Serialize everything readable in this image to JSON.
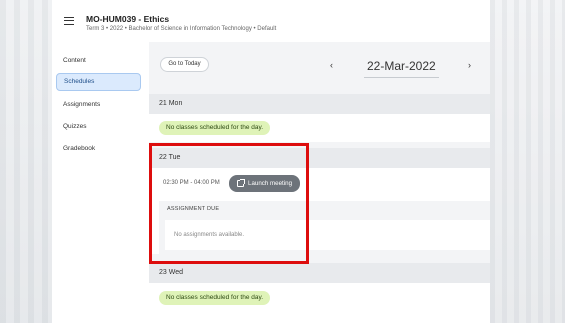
{
  "header": {
    "course_title": "MO-HUM039 - Ethics",
    "course_meta": "Term 3  •  2022  •  Bachelor of Science in Information Technology  •  Default"
  },
  "sidebar": {
    "items": [
      {
        "label": "Content",
        "active": false
      },
      {
        "label": "Schedules",
        "active": true
      },
      {
        "label": "Assignments",
        "active": false
      },
      {
        "label": "Quizzes",
        "active": false
      },
      {
        "label": "Gradebook",
        "active": false
      }
    ]
  },
  "toolbar": {
    "goto_today_label": "Go to Today",
    "current_date": "22-Mar-2022",
    "prev_icon": "chevron-left-icon",
    "next_icon": "chevron-right-icon"
  },
  "days": [
    {
      "label": "21 Mon",
      "message": "No classes scheduled for the day."
    },
    {
      "label": "22 Tue",
      "time": "02:30 PM - 04:00 PM",
      "launch_label": "Launch meeting",
      "assignment_header": "ASSIGNMENT DUE",
      "assignment_empty": "No assignments available."
    },
    {
      "label": "23 Wed",
      "message": "No classes scheduled for the day."
    }
  ],
  "colors": {
    "highlight": "#dd0d0d",
    "active_nav": "#dbeafd",
    "no_class_badge": "#dff3b8",
    "launch_button": "#6d737a"
  }
}
